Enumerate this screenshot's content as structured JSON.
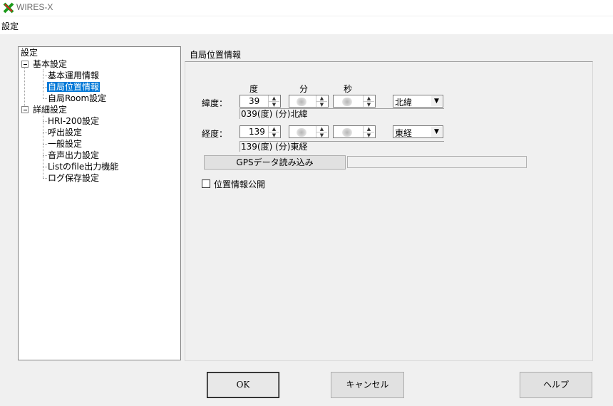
{
  "window": {
    "title": "WIRES-X",
    "icon": "wires-x-logo-icon"
  },
  "menu": {
    "items": [
      "設定"
    ]
  },
  "tree": {
    "root": "設定",
    "group1": "基本設定",
    "group1_items": [
      "基本運用情報",
      "自局位置情報",
      "自局Room設定"
    ],
    "group2": "詳細設定",
    "group2_items": [
      "HRI-200設定",
      "呼出設定",
      "一般設定",
      "音声出力設定",
      "Listのfile出力機能",
      "ログ保存設定"
    ],
    "selected": "自局位置情報"
  },
  "panel": {
    "title": "自局位置情報",
    "headers": {
      "deg": "度",
      "min": "分",
      "sec": "秒"
    },
    "latitude": {
      "label": "緯度：",
      "deg": "39",
      "min": "",
      "sec": "",
      "hemisphere": "北緯",
      "readout": "039(度)    (分)北緯"
    },
    "longitude": {
      "label": "経度：",
      "deg": "139",
      "min": "",
      "sec": "",
      "hemisphere": "東経",
      "readout": "139(度)    (分)東経"
    },
    "gps_button": "GPSデータ読み込み",
    "publish_checkbox": {
      "label": "位置情報公開",
      "checked": false
    }
  },
  "buttons": {
    "ok": "OK",
    "cancel": "キャンセル",
    "help": "ヘルプ"
  }
}
